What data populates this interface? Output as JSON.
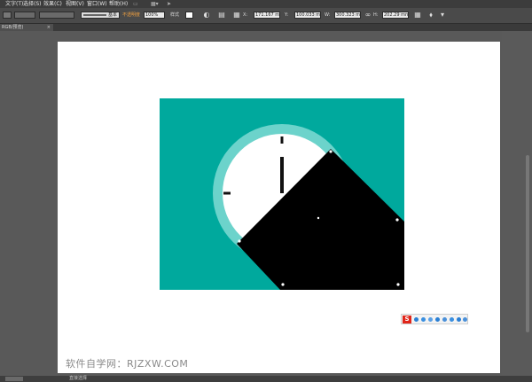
{
  "menu": {
    "items": [
      "文字(T)",
      "选择(S)",
      "效果(C)",
      "视图(V)",
      "窗口(W)",
      "帮助(H)"
    ]
  },
  "control_bar": {
    "stroke_basic_label": "基本",
    "opacity_label": "不透明度",
    "opacity_value": "100%",
    "style_label": "样式",
    "x_value": "171.167 mm",
    "y_value": "100.033 mm",
    "w_value": "300.323 mm",
    "h_value": "202.29 mm"
  },
  "document_tab": {
    "label": "RGB/预览)",
    "close": "×"
  },
  "status_bar": {
    "text": "直接选择"
  },
  "watermark": {
    "text": "软件自学网：RJZXW.COM"
  },
  "ime": {
    "logo": "S"
  },
  "colors": {
    "teal_background": "#00A99D",
    "clock_ring": "#6CD3CB",
    "clock_face": "#FFFFFF",
    "shape_fill": "#000000",
    "selection_handle": "#FFFFFF"
  }
}
